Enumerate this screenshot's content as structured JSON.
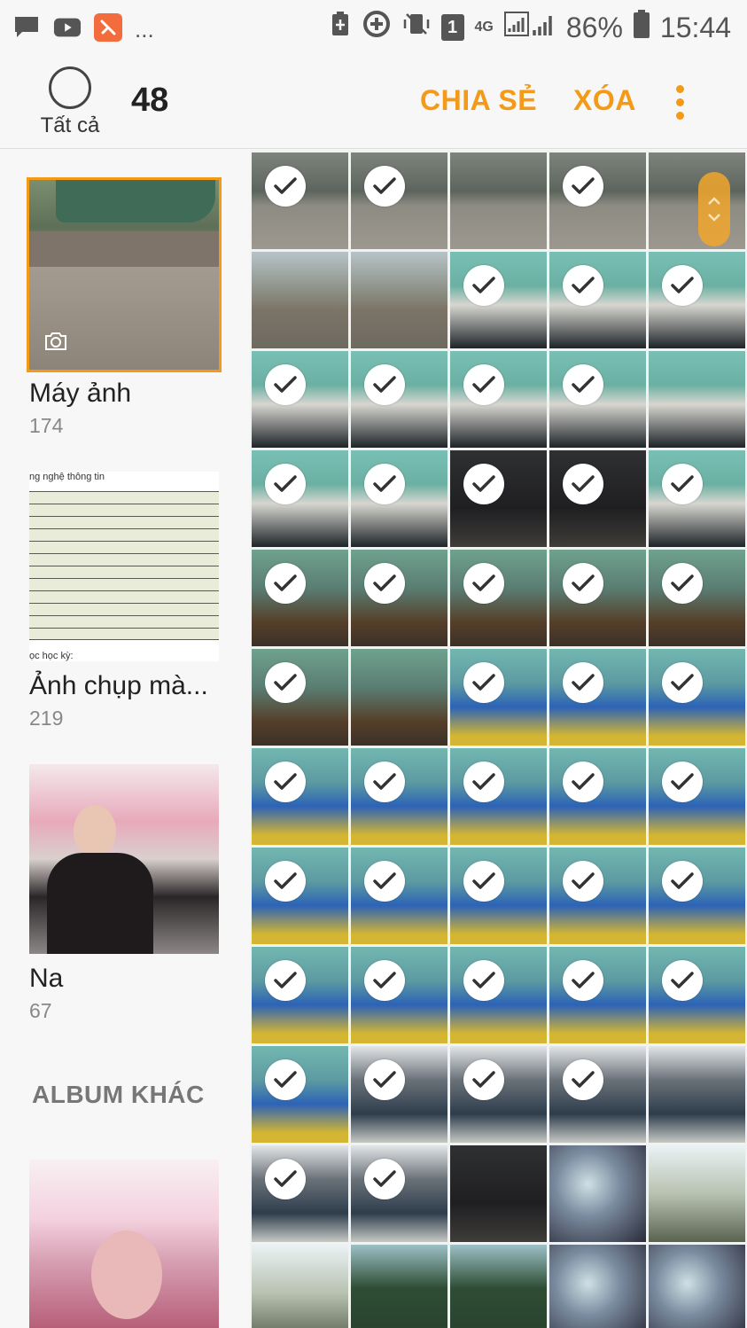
{
  "status_bar": {
    "battery": "86%",
    "time": "15:44",
    "network": "4G",
    "sim": "1",
    "more_apps": "..."
  },
  "header": {
    "select_all_label": "Tất cả",
    "selected_count": "48",
    "share_label": "CHIA SẺ",
    "delete_label": "XÓA"
  },
  "albums": [
    {
      "title": "Máy ảnh",
      "count": "174"
    },
    {
      "title": "Ảnh chụp mà...",
      "count": "219"
    },
    {
      "title": "Na",
      "count": "67"
    }
  ],
  "other_albums_label": "ALBUM KHÁC",
  "doc_thumb": {
    "header": "ng nghệ thông tin",
    "footer": "ọc học kỳ:"
  },
  "photo_styles": [
    "ph-grass",
    "ph-grass",
    "ph-grass",
    "ph-grass",
    "ph-grass",
    "ph-floor",
    "ph-floor",
    "ph-teal",
    "ph-teal",
    "ph-teal",
    "ph-teal",
    "ph-teal",
    "ph-teal",
    "ph-teal",
    "ph-teal",
    "ph-teal",
    "ph-teal",
    "ph-dark",
    "ph-dark",
    "ph-teal",
    "ph-room",
    "ph-room",
    "ph-room",
    "ph-room",
    "ph-room",
    "ph-room",
    "ph-room",
    "ph-blue",
    "ph-blue",
    "ph-blue",
    "ph-blue",
    "ph-blue",
    "ph-blue",
    "ph-blue",
    "ph-blue",
    "ph-blue",
    "ph-blue",
    "ph-blue",
    "ph-blue",
    "ph-blue",
    "ph-blue",
    "ph-blue",
    "ph-blue",
    "ph-blue",
    "ph-blue",
    "ph-blue",
    "ph-night",
    "ph-night",
    "ph-night",
    "ph-night",
    "ph-night",
    "ph-night",
    "ph-dark",
    "ph-light",
    "ph-sky",
    "ph-sky",
    "ph-green",
    "ph-green",
    "ph-light",
    "ph-light"
  ],
  "photo_checked": [
    true,
    true,
    false,
    true,
    false,
    false,
    false,
    true,
    true,
    true,
    true,
    true,
    true,
    true,
    false,
    true,
    true,
    true,
    true,
    true,
    true,
    true,
    true,
    true,
    true,
    true,
    false,
    true,
    true,
    true,
    true,
    true,
    true,
    true,
    true,
    true,
    true,
    true,
    true,
    true,
    true,
    true,
    true,
    true,
    true,
    true,
    true,
    true,
    true,
    false,
    true,
    true,
    false,
    false,
    false,
    false,
    false,
    false,
    false,
    false
  ]
}
